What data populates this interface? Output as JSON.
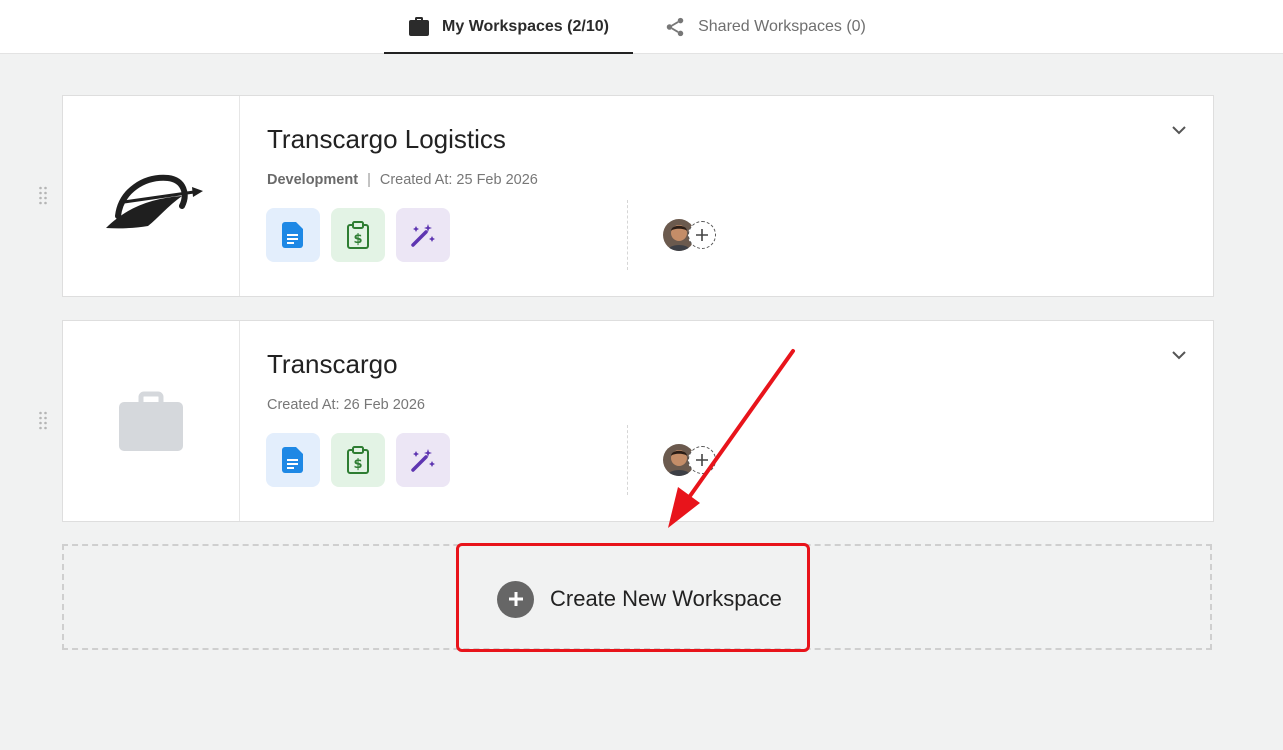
{
  "tabs": [
    {
      "label": "My Workspaces (2/10)",
      "icon": "briefcase-icon",
      "active": true
    },
    {
      "label": "Shared Workspaces (0)",
      "icon": "share-icon",
      "active": false
    }
  ],
  "workspaces": [
    {
      "name": "Transcargo Logistics",
      "environment": "Development",
      "separator": "|",
      "created": "Created At: 25 Feb 2026",
      "logo": "transcargo-logo",
      "apps": [
        "document-icon",
        "invoice-clipboard-icon",
        "magic-wand-icon"
      ],
      "member_avatar": "user-avatar"
    },
    {
      "name": "Transcargo",
      "created": "Created At: 26 Feb 2026",
      "logo": "briefcase-placeholder-icon",
      "apps": [
        "document-icon",
        "invoice-clipboard-icon",
        "magic-wand-icon"
      ],
      "member_avatar": "user-avatar"
    }
  ],
  "create": {
    "label": "Create New Workspace",
    "icon": "plus-circle-icon"
  },
  "annotation": {
    "highlight_color": "#e8141b"
  },
  "colors": {
    "accent": "#222222",
    "doc_blue": "#1e88e5",
    "bill_green": "#2e7d32",
    "magic_purple": "#5e35b1"
  }
}
